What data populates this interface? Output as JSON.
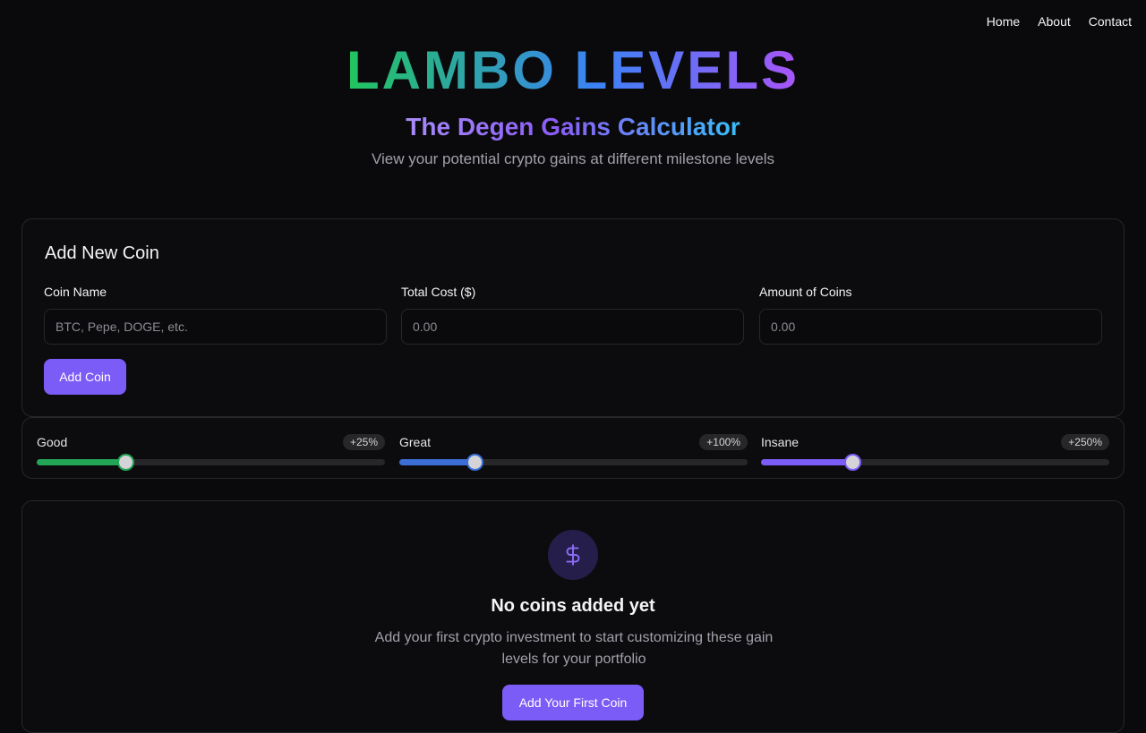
{
  "nav": {
    "items": [
      "Home",
      "About",
      "Contact"
    ]
  },
  "hero": {
    "title": "LAMBO LEVELS",
    "subtitle": "The Degen Gains Calculator",
    "description": "View your potential crypto gains at different milestone levels"
  },
  "add_coin": {
    "heading": "Add New Coin",
    "fields": [
      {
        "label": "Coin Name",
        "placeholder": "BTC, Pepe, DOGE, etc.",
        "value": ""
      },
      {
        "label": "Total Cost ($)",
        "placeholder": "0.00",
        "value": ""
      },
      {
        "label": "Amount of Coins",
        "placeholder": "0.00",
        "value": ""
      }
    ],
    "button": "Add Coin"
  },
  "levels": [
    {
      "name": "Good",
      "badge": "+25%",
      "level": 0.255,
      "color": "#22a555"
    },
    {
      "name": "Great",
      "badge": "+100%",
      "level": 0.215,
      "color": "#3b6fd6"
    },
    {
      "name": "Insane",
      "badge": "+250%",
      "level": 0.262,
      "color": "#7c5cf6"
    }
  ],
  "empty_state": {
    "icon": "dollar-icon",
    "title": "No coins added yet",
    "description": "Add your first crypto investment to start customizing these gain levels for your portfolio",
    "button": "Add Your First Coin"
  },
  "colors": {
    "accent": "#7c5cf6",
    "background": "#0a0a0c",
    "border": "#27272a"
  }
}
